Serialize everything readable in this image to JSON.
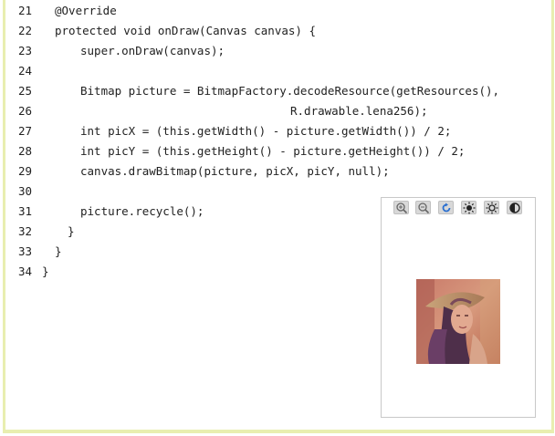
{
  "code": {
    "lines": [
      {
        "num": "21",
        "text": "@Override",
        "indent": 1
      },
      {
        "num": "22",
        "text": "protected void onDraw(Canvas canvas) {",
        "indent": 1
      },
      {
        "num": "23",
        "text": "super.onDraw(canvas);",
        "indent": 2
      },
      {
        "num": "24",
        "text": "",
        "indent": 0
      },
      {
        "num": "25",
        "text": "Bitmap picture = BitmapFactory.decodeResource(getResources(),",
        "indent": 2
      },
      {
        "num": "26",
        "text": "R.drawable.lena256);",
        "indent": 3
      },
      {
        "num": "27",
        "text": "int picX = (this.getWidth() - picture.getWidth()) / 2;",
        "indent": 2
      },
      {
        "num": "28",
        "text": "int picY = (this.getHeight() - picture.getHeight()) / 2;",
        "indent": 2
      },
      {
        "num": "29",
        "text": "canvas.drawBitmap(picture, picX, picY, null);",
        "indent": 2
      },
      {
        "num": "30",
        "text": "",
        "indent": 0
      },
      {
        "num": "31",
        "text": "picture.recycle();",
        "indent": 2
      },
      {
        "num": "32",
        "text": "}",
        "indent": 1.5
      },
      {
        "num": "33",
        "text": "}",
        "indent": 1
      },
      {
        "num": "34",
        "text": "}",
        "indent": 0
      }
    ]
  },
  "viewer": {
    "toolbar": [
      {
        "icon": "zoom-in-icon"
      },
      {
        "icon": "zoom-out-icon"
      },
      {
        "icon": "rotate-icon"
      },
      {
        "icon": "brightness-up-icon"
      },
      {
        "icon": "brightness-down-icon"
      },
      {
        "icon": "contrast-icon"
      }
    ],
    "image_icon": "portrait-photo"
  }
}
